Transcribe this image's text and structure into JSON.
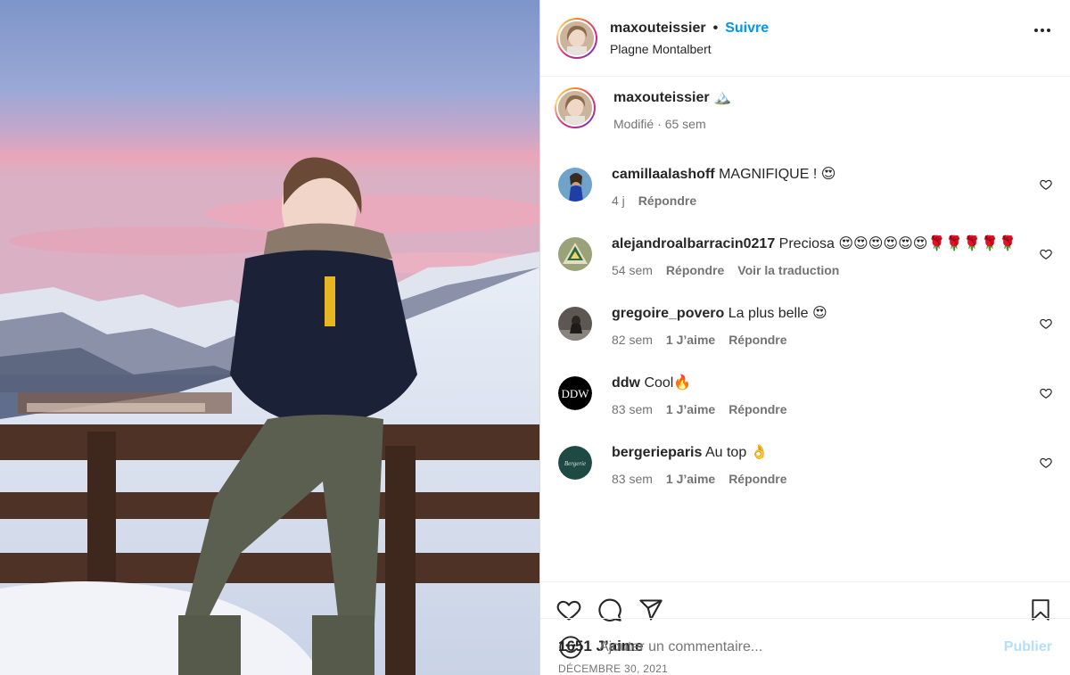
{
  "post": {
    "username": "maxouteissier",
    "follow_label": "Suivre",
    "separator": "•",
    "location": "Plagne Montalbert",
    "more_icon": "more-horizontal-icon"
  },
  "caption": {
    "author": "maxouteissier",
    "text": "🏔️",
    "edited": "Modifié",
    "time": "· 65 sem"
  },
  "comments": [
    {
      "author": "camillaalashoff",
      "text": "MAGNIFIQUE ! 😍",
      "time": "4 j",
      "likes": "",
      "reply": "Répondre",
      "translate": ""
    },
    {
      "author": "alejandroalbarracin0217",
      "text": "Preciosa 😍😍😍😍😍😍🌹🌹🌹🌹🌹",
      "time": "54 sem",
      "likes": "",
      "reply": "Répondre",
      "translate": "Voir la traduction"
    },
    {
      "author": "gregoire_povero",
      "text": "La plus belle 😍",
      "time": "82 sem",
      "likes": "1 J’aime",
      "reply": "Répondre",
      "translate": ""
    },
    {
      "author": "ddw",
      "text": "Cool🔥",
      "time": "83 sem",
      "likes": "1 J’aime",
      "reply": "Répondre",
      "translate": ""
    },
    {
      "author": "bergerieparis",
      "text": "Au top 👌",
      "time": "83 sem",
      "likes": "1 J’aime",
      "reply": "Répondre",
      "translate": ""
    }
  ],
  "avatar_labels": {
    "ddw": "DDW",
    "bergerie": "Bergerie"
  },
  "stats": {
    "likes": "1651 J’aime",
    "date": "DÉCEMBRE 30, 2021"
  },
  "composer": {
    "placeholder": "Ajouter un commentaire...",
    "publish_label": "Publier"
  },
  "colors": {
    "accent": "#0095f6",
    "publish_disabled": "#b2dffc",
    "muted": "#737373"
  }
}
